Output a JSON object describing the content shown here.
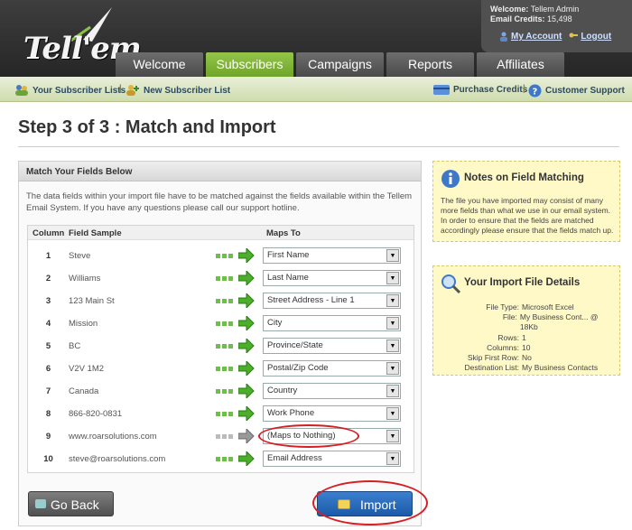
{
  "logo_text": "Tell'em",
  "user": {
    "welcome_label": "Welcome:",
    "welcome_name": "Tellem Admin",
    "credits_label": "Email Credits:",
    "credits_value": "15,498",
    "my_account": "My Account",
    "logout": "Logout"
  },
  "tabs": [
    {
      "label": "Welcome"
    },
    {
      "label": "Subscribers"
    },
    {
      "label": "Campaigns"
    },
    {
      "label": "Reports"
    },
    {
      "label": "Affiliates"
    }
  ],
  "subnav": {
    "your_lists": "Your Subscriber Lists",
    "sep": "|",
    "new_list": "New Subscriber List",
    "purchase": "Purchase Credits",
    "support": "Customer Support"
  },
  "page_title": "Step 3 of 3 : Match and Import",
  "panel": {
    "heading": "Match Your Fields Below",
    "description": "The data fields within your import file have to be matched against the fields available within the Tellem Email System. If you have any questions please call our support hotline.",
    "col_column": "Column",
    "col_sample": "Field Sample",
    "col_maps": "Maps To",
    "rows": [
      {
        "num": "1",
        "sample": "Steve",
        "maps": "First Name"
      },
      {
        "num": "2",
        "sample": "Williams",
        "maps": "Last Name"
      },
      {
        "num": "3",
        "sample": "123 Main St",
        "maps": "Street Address - Line 1"
      },
      {
        "num": "4",
        "sample": "Mission",
        "maps": "City"
      },
      {
        "num": "5",
        "sample": "BC",
        "maps": "Province/State"
      },
      {
        "num": "6",
        "sample": "V2V 1M2",
        "maps": "Postal/Zip Code"
      },
      {
        "num": "7",
        "sample": "Canada",
        "maps": "Country"
      },
      {
        "num": "8",
        "sample": "866-820-0831",
        "maps": "Work Phone"
      },
      {
        "num": "9",
        "sample": "www.roarsolutions.com",
        "maps": "(Maps to Nothing)"
      },
      {
        "num": "10",
        "sample": "steve@roarsolutions.com",
        "maps": "Email Address"
      }
    ],
    "go_back": "Go Back",
    "import": "Import"
  },
  "notes": {
    "title": "Notes on Field Matching",
    "text": "The file you have imported may consist of many more fields than what we use in our email system. In order to ensure that the fields are matched accordingly please ensure that the fields match up."
  },
  "details": {
    "title": "Your Import File Details",
    "items": [
      {
        "k": "File Type:",
        "v": "Microsoft Excel"
      },
      {
        "k": "File:",
        "v": "My Business Cont... @ 18Kb"
      },
      {
        "k": "Rows:",
        "v": "1"
      },
      {
        "k": "Columns:",
        "v": "10"
      },
      {
        "k": "Skip First Row:",
        "v": "No"
      },
      {
        "k": "Destination List:",
        "v": "My Business Contacts"
      }
    ]
  }
}
